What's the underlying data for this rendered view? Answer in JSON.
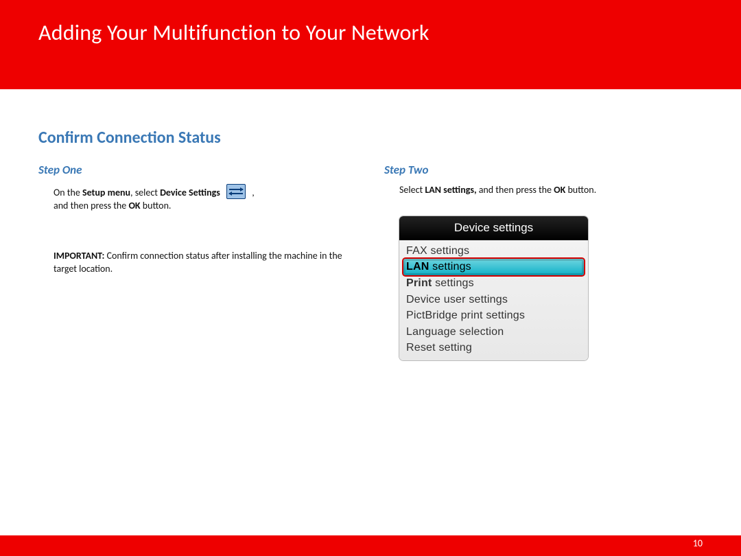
{
  "header": {
    "title": "Adding Your Multifunction to Your Network"
  },
  "section_title": "Confirm Connection Status",
  "step_one": {
    "heading": "Step One",
    "p1_a": "On the ",
    "p1_b": "Setup menu",
    "p1_c": ", select ",
    "p1_d": "Device Settings",
    "p1_e": " ,",
    "p2_a": "and then press the ",
    "p2_b": "OK",
    "p2_c": " button.",
    "imp_a": "IMPORTANT:",
    "imp_b": "  Confirm connection status after installing the machine in the target location."
  },
  "step_two": {
    "heading": "Step Two",
    "p1_a": "Select ",
    "p1_b": "LAN settings,",
    "p1_c": " and then press the ",
    "p1_d": "OK",
    "p1_e": " button."
  },
  "device_menu": {
    "title": "Device settings",
    "items": {
      "0": "FAX settings",
      "1_a": "LAN",
      "1_b": "  settings",
      "2_a": "Print",
      "2_b": " settings",
      "3": "Device user settings",
      "4": "PictBridge print settings",
      "5": "Language selection",
      "6": "Reset setting"
    }
  },
  "icon_name": "device-settings-icon",
  "page_number": "10"
}
